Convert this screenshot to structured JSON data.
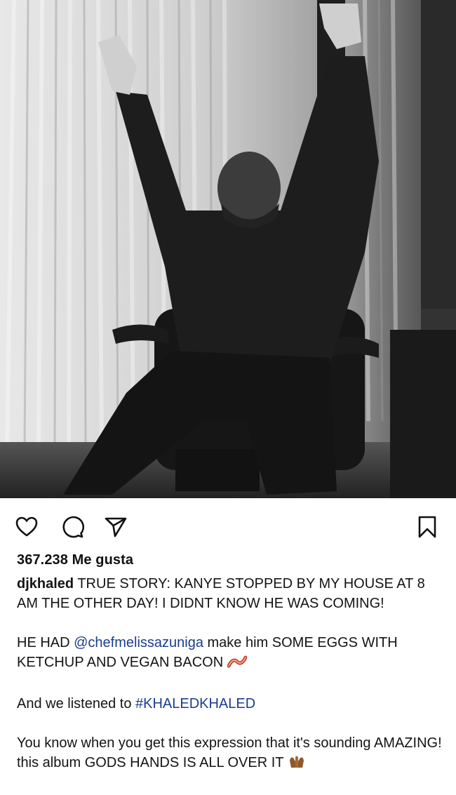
{
  "post": {
    "photo": {
      "alt": "Black and white photo of a man in dark clothes sitting in an office chair with both arms raised",
      "style": "black-and-white"
    },
    "actions": {
      "like_icon": "heart-icon",
      "comment_icon": "comment-bubble-icon",
      "share_icon": "paper-plane-icon",
      "save_icon": "bookmark-icon"
    },
    "likes_text": "367.238 Me gusta",
    "caption": {
      "username": "djkhaled",
      "p1_text": " TRUE STORY: KANYE STOPPED BY MY HOUSE AT 8 AM THE OTHER DAY! I DIDNT KNOW HE WAS COMING!",
      "p2_before": "HE HAD ",
      "p2_mention": "@chefmelissazuniga",
      "p2_after": " make him SOME EGGS WITH KETCHUP AND VEGAN BACON ",
      "p2_emoji": "bacon-icon",
      "p3_before": "And we listened to ",
      "p3_hashtag": "#KHALEDKHALED",
      "p4_text": "You know when you get this expression that it's sounding AMAZING! this album GODS HANDS IS ALL OVER IT ",
      "p4_emoji": "praying-hands-icon"
    },
    "colors": {
      "link": "#1b3d8f",
      "text": "#141414"
    }
  }
}
